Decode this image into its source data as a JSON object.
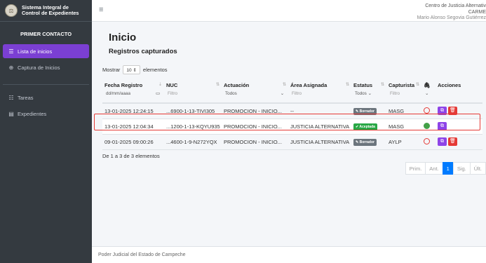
{
  "sidebar": {
    "brand": {
      "line1": "Sistema Integral de",
      "line2": "Control de Expedientes",
      "logo_icon": "seal-logo"
    },
    "menu_header": "PRIMER CONTACTO",
    "items": [
      {
        "label": "Lista de inicios",
        "icon": "list-icon",
        "active": true
      },
      {
        "label": "Captura de Inicios",
        "icon": "plus-circle-icon",
        "active": false
      },
      {
        "label": "Tareas",
        "icon": "tasks-icon",
        "active": false
      },
      {
        "label": "Expedientes",
        "icon": "folder-icon",
        "active": false
      }
    ]
  },
  "header": {
    "org": "Centro de Justicia Alternativ",
    "user_code": "CARME",
    "user_name": "Mario Alonso Segovia Gutiérrez"
  },
  "main": {
    "title": "Inicio",
    "section": "Registros capturados",
    "length": {
      "prefix": "Mostrar",
      "value": "10",
      "suffix": "elementos"
    },
    "columns": [
      "Fecha Registro",
      "NUC",
      "Actuación",
      "Área Asignada",
      "Estatus",
      "Capturista",
      "",
      "Acciones"
    ],
    "filters": {
      "date": "dd/mm/aaaa",
      "nuc": "Filtro",
      "actuacion": "Todos",
      "area": "Filtro",
      "estatus": "Todos",
      "capturista": "Filtro"
    },
    "rows": [
      {
        "fecha": "13-01-2025 12:24:15",
        "nuc": "...6900-1-13-TIVI305",
        "actuacion": "PROMOCION - INICIO...",
        "area": "--",
        "estatus": "Borrador",
        "capturista": "MASG",
        "attached": false
      },
      {
        "fecha": "13-01-2025 12:04:34",
        "nuc": "...1200-1-13-KQYU935",
        "actuacion": "PROMOCION - INICIO...",
        "area": "JUSTICIA ALTERNATIVA",
        "estatus": "Aceptada",
        "capturista": "MASG",
        "attached": true
      },
      {
        "fecha": "09-01-2025 09:00:26",
        "nuc": "...4600-1-9-N272YQX",
        "actuacion": "PROMOCION - INICIO...",
        "area": "JUSTICIA ALTERNATIVA",
        "estatus": "Borrador",
        "capturista": "AYLP",
        "attached": false
      }
    ],
    "info": "De 1 a 3 de 3 elementos",
    "pagination": [
      "Prim.",
      "Ant.",
      "1",
      "Sig.",
      "Últ."
    ]
  },
  "footer": {
    "text": "Poder Judicial del Estado de Campeche"
  },
  "colors": {
    "accent": "#7b3fd3",
    "danger": "#e53935",
    "success": "#43a047",
    "sidebar_bg": "#343a40"
  }
}
